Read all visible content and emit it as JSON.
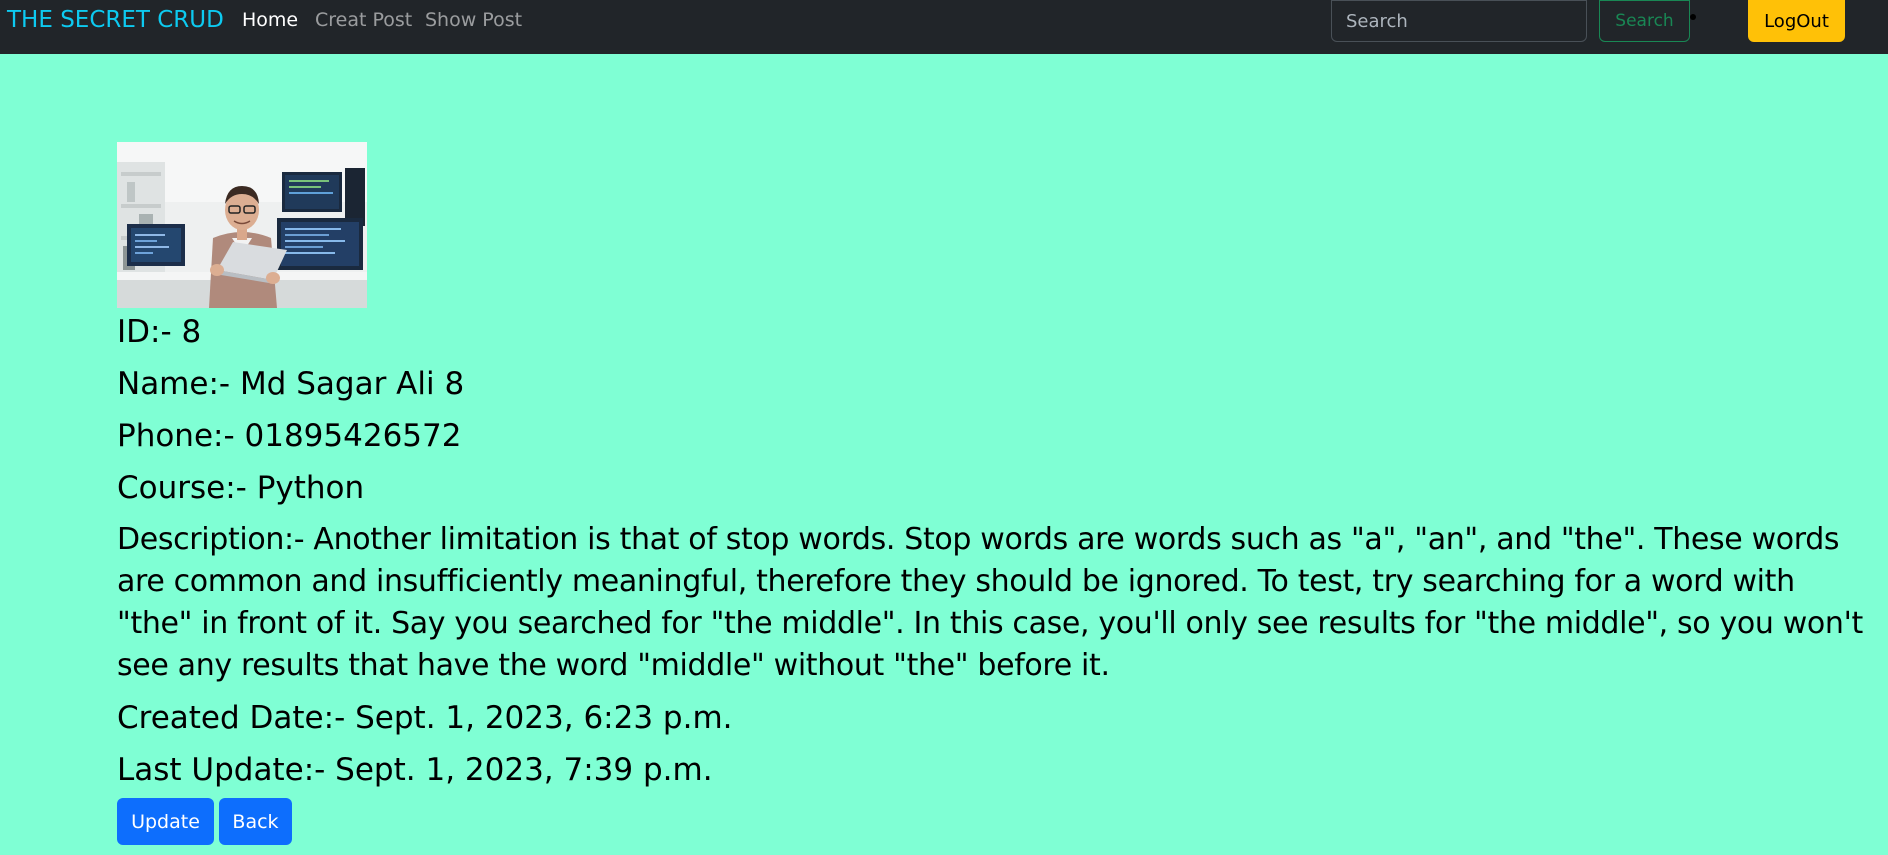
{
  "navbar": {
    "brand": "THE SECRET CRUD",
    "links": [
      {
        "label": "Home"
      },
      {
        "label": "Creat Post"
      },
      {
        "label": "Show Post"
      }
    ],
    "search": {
      "placeholder": "Search",
      "value": "",
      "button_label": "Search"
    },
    "logout_label": "LogOut",
    "colors": {
      "background": "#212529",
      "brand": "#0dcaf0",
      "search_button": "#198754",
      "logout_button": "#ffc107"
    }
  },
  "post": {
    "photo_icon": "person-with-laptop-photo",
    "id_line": "ID:- 8",
    "name_line": "Name:- Md Sagar Ali 8",
    "phone_line": "Phone:- 01895426572",
    "course_line": "Course:- Python",
    "description_line": "Description:- Another limitation is that of stop words. Stop words are words such as \"a\", \"an\", and \"the\". These words are common and insufficiently meaningful, therefore they should be ignored. To test, try searching for a word with \"the\" in front of it. Say you searched for \"the middle\". In this case, you'll only see results for \"the middle\", so you won't see any results that have the word \"middle\" without \"the\" before it.",
    "created_line": "Created Date:- Sept. 1, 2023, 6:23 p.m.",
    "updated_line": "Last Update:- Sept. 1, 2023, 7:39 p.m."
  },
  "actions": {
    "update_label": "Update",
    "back_label": "Back"
  },
  "colors": {
    "page_background": "#7fffd4",
    "primary_button": "#0d6efd"
  }
}
